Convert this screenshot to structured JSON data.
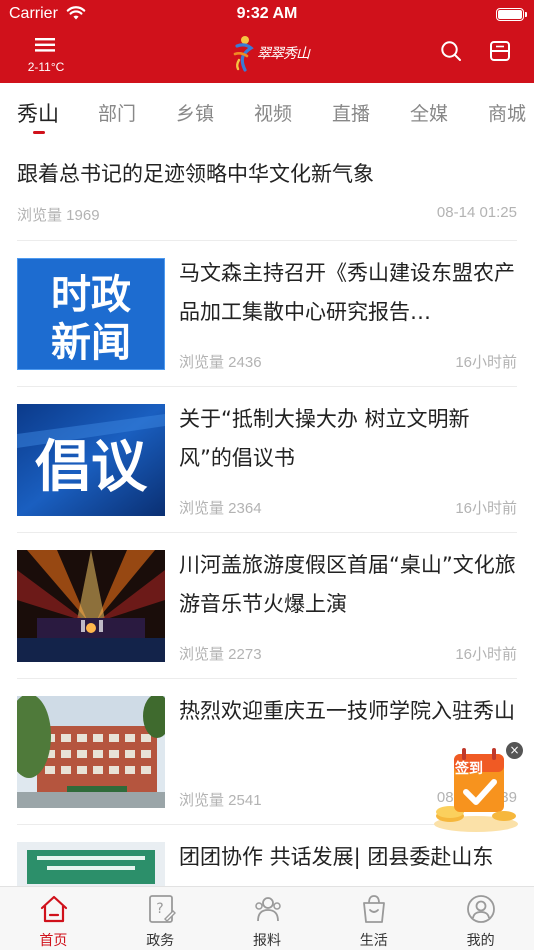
{
  "status_bar": {
    "carrier": "Carrier",
    "time": "9:32 AM"
  },
  "header": {
    "weather": "2-11°C",
    "logo_text": "翠翠秀山",
    "accent_color": "#d0111b"
  },
  "tabs": [
    {
      "label": "秀山",
      "active": true
    },
    {
      "label": "部门"
    },
    {
      "label": "乡镇"
    },
    {
      "label": "视频"
    },
    {
      "label": "直播"
    },
    {
      "label": "全媒"
    },
    {
      "label": "商城"
    }
  ],
  "feed": {
    "top": {
      "title": "跟着总书记的足迹领略中华文化新气象",
      "views": "浏览量 1969",
      "time": "08-14 01:25"
    },
    "items": [
      {
        "title": "马文森主持召开《秀山建设东盟农产品加工集散中心研究报告…",
        "views": "浏览量 2436",
        "time": "16小时前",
        "thumb_text": "时政\n新闻",
        "thumb_icon": "news-banner-image"
      },
      {
        "title": "关于“抵制大操大办 树立文明新风”的倡议书",
        "views": "浏览量 2364",
        "time": "16小时前",
        "thumb_text": "倡议",
        "thumb_icon": "proposal-banner-image"
      },
      {
        "title": "川河盖旅游度假区首届“桌山”文化旅游音乐节火爆上演",
        "views": "浏览量 2273",
        "time": "16小时前",
        "thumb_icon": "concert-stage-photo"
      },
      {
        "title": "热烈欢迎重庆五一技师学院入驻秀山",
        "views": "浏览量 2541",
        "time": "08-14 01:39",
        "thumb_icon": "school-building-photo"
      },
      {
        "title": "团团协作 共话发展| 团县委赴山东",
        "views": "",
        "time": "",
        "thumb_icon": "meeting-room-photo"
      }
    ]
  },
  "signin": {
    "label": "签到"
  },
  "bottom_nav": [
    {
      "label": "首页",
      "icon": "home-icon",
      "active": true
    },
    {
      "label": "政务",
      "icon": "affairs-icon"
    },
    {
      "label": "报料",
      "icon": "report-icon"
    },
    {
      "label": "生活",
      "icon": "life-icon"
    },
    {
      "label": "我的",
      "icon": "profile-icon"
    }
  ]
}
